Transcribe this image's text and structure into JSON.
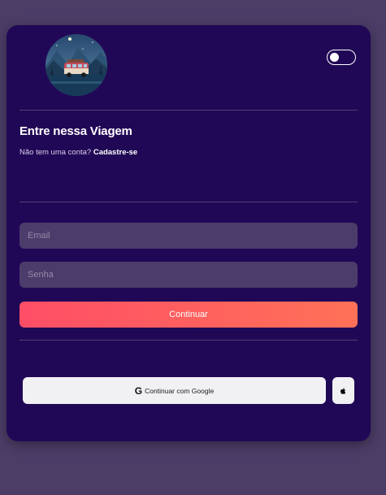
{
  "theme": {
    "page_background": "#4b3d66",
    "card_background": "#210856",
    "input_background": "#4c3c6b",
    "accent_gradient": [
      "#ff4e66",
      "#ff7157"
    ]
  },
  "header": {
    "logo": "night-van-landscape-logo",
    "dark_mode_toggle": {
      "state": "off"
    }
  },
  "login": {
    "title": "Entre nessa Viagem",
    "signup_prompt": "Não tem uma conta?",
    "signup_link": "Cadastre-se",
    "email_placeholder": "Email",
    "email_value": "",
    "password_placeholder": "Senha",
    "password_value": "",
    "continue_label": "Continuar"
  },
  "social": {
    "google_icon": "G",
    "google_label": "Continuar com Google",
    "apple_icon": "apple-icon"
  }
}
